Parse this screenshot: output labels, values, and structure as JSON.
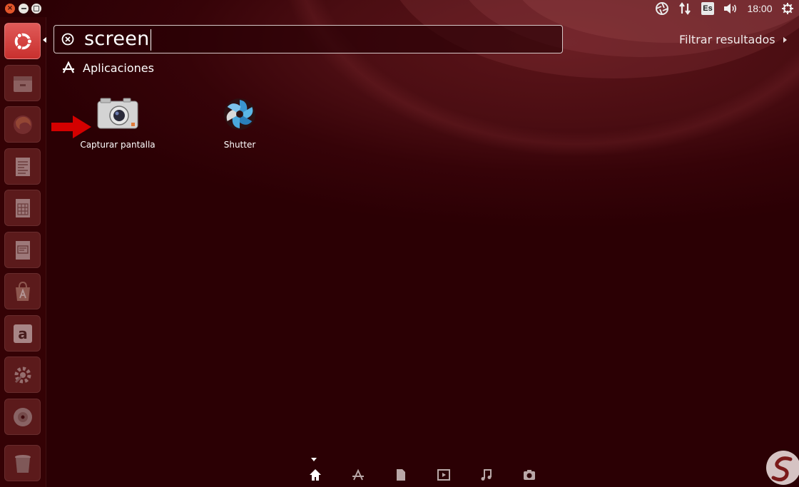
{
  "window_controls": {
    "close_icon": "close-icon",
    "minimize_icon": "minimize-icon",
    "maximize_icon": "maximize-icon"
  },
  "top_panel": {
    "indicators": [
      {
        "name": "shutter-tray-icon"
      },
      {
        "name": "network-icon"
      },
      {
        "name": "keyboard-layout-indicator",
        "text": "Es"
      },
      {
        "name": "volume-icon"
      },
      {
        "name": "clock",
        "text": "18:00"
      },
      {
        "name": "power-icon"
      }
    ]
  },
  "launcher": {
    "items": [
      {
        "name": "launcher-dash-home",
        "icon": "ubuntu-logo-icon",
        "active": true
      },
      {
        "name": "launcher-files",
        "icon": "files-icon"
      },
      {
        "name": "launcher-firefox",
        "icon": "firefox-icon"
      },
      {
        "name": "launcher-writer",
        "icon": "writer-icon"
      },
      {
        "name": "launcher-calc",
        "icon": "calc-icon"
      },
      {
        "name": "launcher-impress",
        "icon": "impress-icon"
      },
      {
        "name": "launcher-software-center",
        "icon": "software-center-icon"
      },
      {
        "name": "launcher-amazon",
        "icon": "amazon-icon"
      },
      {
        "name": "launcher-system-settings",
        "icon": "settings-icon"
      },
      {
        "name": "launcher-dvd",
        "icon": "dvd-icon"
      },
      {
        "name": "launcher-trash",
        "icon": "trash-icon"
      }
    ]
  },
  "search": {
    "query": "screen",
    "clear_icon": "clear-search-icon"
  },
  "filter": {
    "label": "Filtrar resultados"
  },
  "results": {
    "section_title": "Aplicaciones",
    "apps": [
      {
        "label": "Capturar pantalla",
        "icon": "camera-icon"
      },
      {
        "label": "Shutter",
        "icon": "shutter-icon"
      }
    ]
  },
  "lenses": [
    {
      "name": "lens-home",
      "icon": "home-icon",
      "active": true
    },
    {
      "name": "lens-applications",
      "icon": "applications-icon"
    },
    {
      "name": "lens-files",
      "icon": "files-lens-icon"
    },
    {
      "name": "lens-video",
      "icon": "video-icon"
    },
    {
      "name": "lens-music",
      "icon": "music-icon"
    },
    {
      "name": "lens-photos",
      "icon": "photos-icon"
    }
  ],
  "colors": {
    "background": "#2b0004",
    "accent": "#c8302e",
    "arrow": "#d40000"
  }
}
